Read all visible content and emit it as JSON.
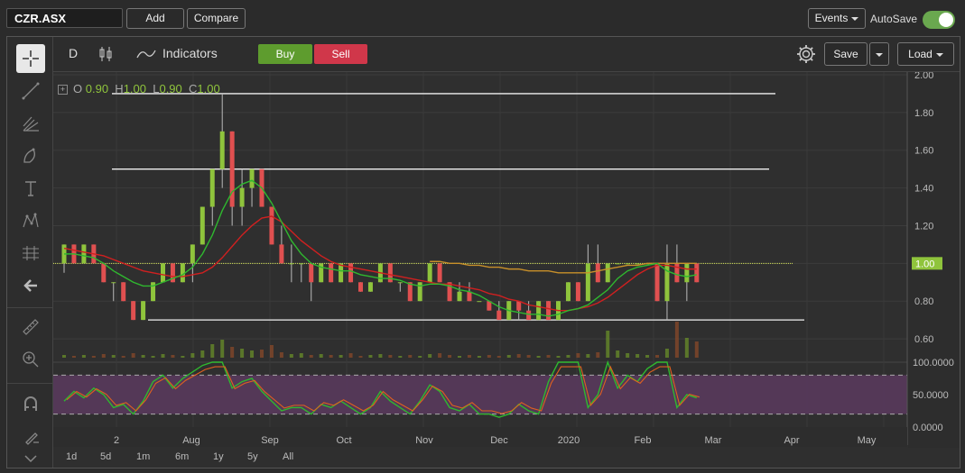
{
  "header": {
    "symbol": "CZR.ASX",
    "add_label": "Add",
    "compare_label": "Compare",
    "events_label": "Events",
    "autosave_label": "AutoSave",
    "autosave_on": true
  },
  "toolbar": {
    "interval": "D",
    "indicators_label": "Indicators",
    "buy_label": "Buy",
    "sell_label": "Sell",
    "save_label": "Save",
    "load_label": "Load"
  },
  "left_tools": [
    "crosshair-icon",
    "trendline-icon",
    "pitchfork-icon",
    "brush-icon",
    "text-icon",
    "pattern-icon",
    "measure-icon",
    "back-arrow-icon",
    "ruler-icon",
    "zoom-in-icon",
    "magnet-icon",
    "lock-icon"
  ],
  "ohlc": {
    "o_label": "O",
    "o": "0.90",
    "h_label": "H",
    "h": "1.00",
    "l_label": "L",
    "l": "0.90",
    "c_label": "C",
    "c": "1.00"
  },
  "price_axis": {
    "labels": [
      "2.00",
      "1.80",
      "1.60",
      "1.40",
      "1.20",
      "1.00",
      "0.80",
      "0.60"
    ],
    "last_price": "1.00"
  },
  "rsi_axis": {
    "labels": [
      "100.0000",
      "50.0000",
      "0.0000"
    ]
  },
  "time_axis": {
    "labels": [
      "2",
      "Aug",
      "Sep",
      "Oct",
      "Nov",
      "Dec",
      "2020",
      "Feb",
      "Mar",
      "Apr",
      "May"
    ]
  },
  "ranges": [
    "1d",
    "5d",
    "1m",
    "6m",
    "1y",
    "5y",
    "All"
  ],
  "colors": {
    "up": "#8fc43c",
    "down": "#e05050",
    "ma_fast": "#2fb82f",
    "ma_slow": "#d02020",
    "rsi_fill": "#5a3a5e",
    "accent": "#6aa84f"
  },
  "chart_data": {
    "type": "candlestick",
    "price_range": [
      0.5,
      2.0
    ],
    "horizontal_lines": [
      1.9,
      1.5,
      1.0,
      0.7
    ],
    "last_price": 1.0,
    "candles": [
      {
        "o": 1.0,
        "h": 1.1,
        "l": 0.95,
        "c": 1.1
      },
      {
        "o": 1.1,
        "h": 1.1,
        "l": 1.0,
        "c": 1.0
      },
      {
        "o": 1.0,
        "h": 1.1,
        "l": 1.0,
        "c": 1.1
      },
      {
        "o": 1.1,
        "h": 1.1,
        "l": 1.0,
        "c": 1.0
      },
      {
        "o": 1.0,
        "h": 1.0,
        "l": 0.9,
        "c": 0.9
      },
      {
        "o": 0.9,
        "h": 0.9,
        "l": 0.8,
        "c": 0.9
      },
      {
        "o": 0.9,
        "h": 0.9,
        "l": 0.8,
        "c": 0.8
      },
      {
        "o": 0.8,
        "h": 0.8,
        "l": 0.7,
        "c": 0.7
      },
      {
        "o": 0.7,
        "h": 0.8,
        "l": 0.7,
        "c": 0.8
      },
      {
        "o": 0.8,
        "h": 0.9,
        "l": 0.8,
        "c": 0.9
      },
      {
        "o": 0.9,
        "h": 1.0,
        "l": 0.9,
        "c": 1.0
      },
      {
        "o": 1.0,
        "h": 1.0,
        "l": 0.9,
        "c": 0.9
      },
      {
        "o": 0.9,
        "h": 1.0,
        "l": 0.9,
        "c": 1.0
      },
      {
        "o": 1.0,
        "h": 1.1,
        "l": 0.9,
        "c": 1.1
      },
      {
        "o": 1.1,
        "h": 1.3,
        "l": 1.1,
        "c": 1.3
      },
      {
        "o": 1.3,
        "h": 1.5,
        "l": 1.2,
        "c": 1.5
      },
      {
        "o": 1.5,
        "h": 1.9,
        "l": 1.4,
        "c": 1.7
      },
      {
        "o": 1.7,
        "h": 1.7,
        "l": 1.2,
        "c": 1.3
      },
      {
        "o": 1.3,
        "h": 1.5,
        "l": 1.2,
        "c": 1.4
      },
      {
        "o": 1.4,
        "h": 1.5,
        "l": 1.3,
        "c": 1.5
      },
      {
        "o": 1.5,
        "h": 1.5,
        "l": 1.3,
        "c": 1.3
      },
      {
        "o": 1.3,
        "h": 1.3,
        "l": 1.1,
        "c": 1.1
      },
      {
        "o": 1.1,
        "h": 1.2,
        "l": 1.0,
        "c": 1.0
      },
      {
        "o": 1.0,
        "h": 1.1,
        "l": 0.9,
        "c": 1.0
      },
      {
        "o": 1.0,
        "h": 1.0,
        "l": 0.9,
        "c": 1.0
      },
      {
        "o": 1.0,
        "h": 1.0,
        "l": 0.8,
        "c": 0.9
      },
      {
        "o": 0.9,
        "h": 1.0,
        "l": 0.9,
        "c": 1.0
      },
      {
        "o": 1.0,
        "h": 1.0,
        "l": 0.9,
        "c": 0.9
      },
      {
        "o": 0.9,
        "h": 1.0,
        "l": 0.9,
        "c": 1.0
      },
      {
        "o": 1.0,
        "h": 1.0,
        "l": 0.9,
        "c": 0.9
      },
      {
        "o": 0.9,
        "h": 0.9,
        "l": 0.85,
        "c": 0.85
      },
      {
        "o": 0.85,
        "h": 0.9,
        "l": 0.85,
        "c": 0.9
      },
      {
        "o": 0.9,
        "h": 1.0,
        "l": 0.9,
        "c": 1.0
      },
      {
        "o": 1.0,
        "h": 1.0,
        "l": 0.9,
        "c": 0.9
      },
      {
        "o": 0.9,
        "h": 0.9,
        "l": 0.85,
        "c": 0.9
      },
      {
        "o": 0.9,
        "h": 0.9,
        "l": 0.8,
        "c": 0.8
      },
      {
        "o": 0.8,
        "h": 0.9,
        "l": 0.8,
        "c": 0.9
      },
      {
        "o": 0.9,
        "h": 1.0,
        "l": 0.9,
        "c": 1.0
      },
      {
        "o": 1.0,
        "h": 1.0,
        "l": 0.9,
        "c": 0.9
      },
      {
        "o": 0.9,
        "h": 0.9,
        "l": 0.8,
        "c": 0.8
      },
      {
        "o": 0.8,
        "h": 0.9,
        "l": 0.8,
        "c": 0.85
      },
      {
        "o": 0.85,
        "h": 0.9,
        "l": 0.8,
        "c": 0.8
      },
      {
        "o": 0.8,
        "h": 0.8,
        "l": 0.8,
        "c": 0.8
      },
      {
        "o": 0.8,
        "h": 0.8,
        "l": 0.75,
        "c": 0.75
      },
      {
        "o": 0.75,
        "h": 0.8,
        "l": 0.7,
        "c": 0.7
      },
      {
        "o": 0.7,
        "h": 0.8,
        "l": 0.7,
        "c": 0.8
      },
      {
        "o": 0.8,
        "h": 0.8,
        "l": 0.7,
        "c": 0.75
      },
      {
        "o": 0.75,
        "h": 0.8,
        "l": 0.7,
        "c": 0.7
      },
      {
        "o": 0.7,
        "h": 0.8,
        "l": 0.7,
        "c": 0.8
      },
      {
        "o": 0.8,
        "h": 0.8,
        "l": 0.7,
        "c": 0.7
      },
      {
        "o": 0.7,
        "h": 0.8,
        "l": 0.7,
        "c": 0.8
      },
      {
        "o": 0.8,
        "h": 0.9,
        "l": 0.8,
        "c": 0.9
      },
      {
        "o": 0.9,
        "h": 0.9,
        "l": 0.8,
        "c": 0.8
      },
      {
        "o": 0.8,
        "h": 1.1,
        "l": 0.8,
        "c": 1.0
      },
      {
        "o": 1.0,
        "h": 1.1,
        "l": 0.9,
        "c": 0.9
      },
      {
        "o": 0.9,
        "h": 1.0,
        "l": 0.9,
        "c": 1.0
      },
      {
        "o": 1.0,
        "h": 1.0,
        "l": 1.0,
        "c": 1.0
      },
      {
        "o": 1.0,
        "h": 1.0,
        "l": 1.0,
        "c": 1.0
      },
      {
        "o": 1.0,
        "h": 1.0,
        "l": 1.0,
        "c": 1.0
      },
      {
        "o": 1.0,
        "h": 1.0,
        "l": 1.0,
        "c": 1.0
      },
      {
        "o": 1.0,
        "h": 1.0,
        "l": 0.8,
        "c": 0.8
      },
      {
        "o": 0.8,
        "h": 1.1,
        "l": 0.7,
        "c": 1.0
      },
      {
        "o": 1.0,
        "h": 1.1,
        "l": 0.9,
        "c": 0.9
      },
      {
        "o": 0.9,
        "h": 1.0,
        "l": 0.8,
        "c": 1.0
      },
      {
        "o": 1.0,
        "h": 1.0,
        "l": 0.9,
        "c": 0.9
      }
    ],
    "ma_fast": [
      1.05,
      1.05,
      1.04,
      1.03,
      1.0,
      0.96,
      0.93,
      0.9,
      0.88,
      0.88,
      0.9,
      0.92,
      0.94,
      0.98,
      1.05,
      1.15,
      1.28,
      1.38,
      1.42,
      1.44,
      1.4,
      1.32,
      1.22,
      1.12,
      1.05,
      1.0,
      0.98,
      0.97,
      0.96,
      0.96,
      0.94,
      0.93,
      0.92,
      0.92,
      0.91,
      0.89,
      0.88,
      0.89,
      0.89,
      0.88,
      0.86,
      0.85,
      0.83,
      0.8,
      0.77,
      0.75,
      0.74,
      0.73,
      0.73,
      0.72,
      0.73,
      0.75,
      0.76,
      0.78,
      0.82,
      0.86,
      0.92,
      0.96,
      0.98,
      0.99,
      1.0,
      0.96,
      0.94,
      0.93,
      0.94
    ],
    "ma_slow": [
      1.08,
      1.07,
      1.06,
      1.05,
      1.04,
      1.02,
      1.0,
      0.98,
      0.96,
      0.95,
      0.94,
      0.93,
      0.93,
      0.94,
      0.95,
      0.98,
      1.03,
      1.09,
      1.15,
      1.2,
      1.24,
      1.25,
      1.22,
      1.17,
      1.12,
      1.08,
      1.04,
      1.01,
      0.99,
      0.98,
      0.97,
      0.96,
      0.95,
      0.94,
      0.93,
      0.92,
      0.91,
      0.9,
      0.89,
      0.89,
      0.88,
      0.87,
      0.86,
      0.84,
      0.83,
      0.81,
      0.8,
      0.78,
      0.77,
      0.76,
      0.75,
      0.75,
      0.76,
      0.77,
      0.79,
      0.82,
      0.86,
      0.9,
      0.94,
      0.97,
      0.99,
      0.99,
      0.98,
      0.97,
      0.97
    ],
    "ma_long": [
      null,
      null,
      null,
      null,
      null,
      null,
      null,
      null,
      null,
      null,
      null,
      null,
      null,
      null,
      null,
      null,
      null,
      null,
      null,
      null,
      null,
      null,
      null,
      null,
      null,
      null,
      null,
      null,
      null,
      null,
      null,
      null,
      null,
      null,
      null,
      null,
      null,
      1.01,
      1.01,
      1.0,
      1.0,
      0.99,
      0.99,
      0.98,
      0.98,
      0.97,
      0.97,
      0.96,
      0.96,
      0.96,
      0.95,
      0.95,
      0.95,
      0.95,
      0.96,
      0.97,
      0.98,
      0.99,
      0.99,
      1.0,
      1.0,
      1.0,
      1.0,
      1.0,
      1.0
    ],
    "volume": [
      3,
      2,
      3,
      2,
      4,
      3,
      2,
      5,
      3,
      2,
      4,
      3,
      2,
      5,
      8,
      15,
      20,
      12,
      10,
      8,
      9,
      14,
      6,
      4,
      5,
      3,
      4,
      3,
      3,
      5,
      2,
      3,
      4,
      3,
      2,
      3,
      2,
      4,
      5,
      3,
      2,
      3,
      2,
      3,
      2,
      3,
      4,
      3,
      2,
      3,
      2,
      3,
      5,
      4,
      6,
      30,
      8,
      5,
      4,
      3,
      3,
      10,
      40,
      22,
      18
    ],
    "rsi": [
      40,
      55,
      45,
      60,
      50,
      30,
      35,
      20,
      40,
      70,
      80,
      60,
      75,
      85,
      95,
      100,
      100,
      60,
      70,
      75,
      55,
      40,
      25,
      30,
      30,
      20,
      35,
      30,
      40,
      30,
      20,
      30,
      55,
      40,
      30,
      20,
      40,
      65,
      55,
      30,
      25,
      35,
      20,
      20,
      15,
      20,
      35,
      25,
      20,
      70,
      100,
      100,
      100,
      30,
      50,
      100,
      60,
      80,
      70,
      90,
      100,
      100,
      30,
      50,
      45
    ],
    "rsi_range": [
      0,
      100
    ],
    "rsi_levels": [
      80,
      20
    ]
  }
}
